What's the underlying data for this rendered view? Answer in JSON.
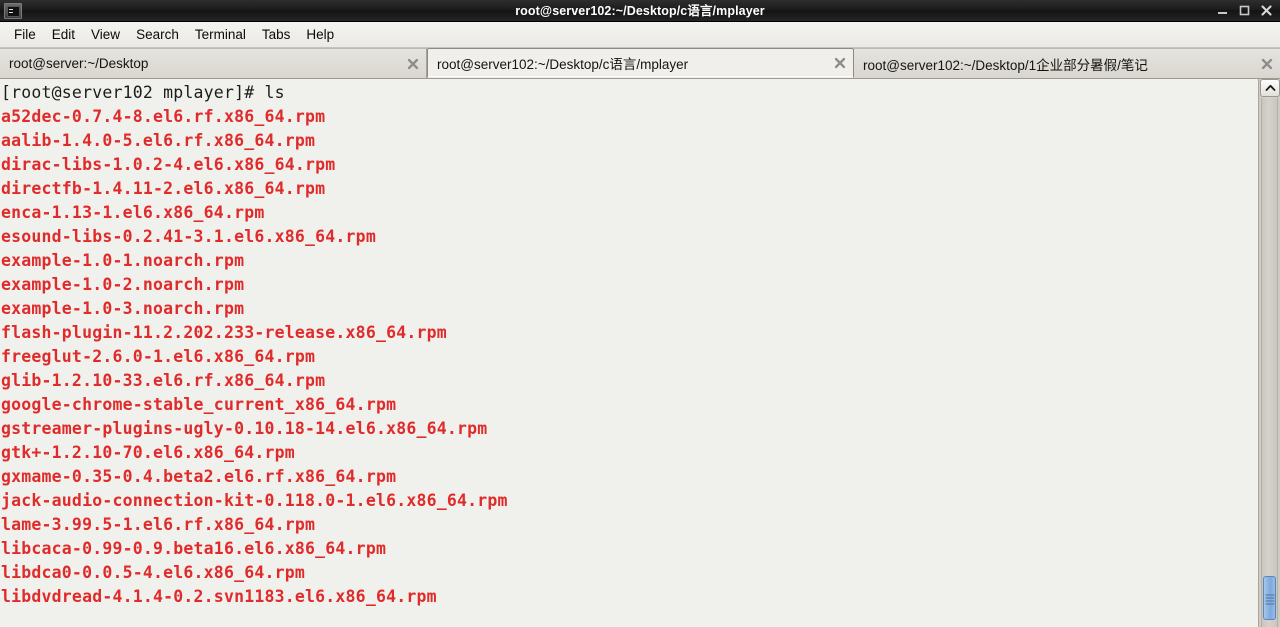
{
  "window": {
    "title": "root@server102:~/Desktop/c语言/mplayer",
    "icon": "terminal-icon",
    "minimize_label": "_",
    "maximize_label": "□",
    "close_label": "✕"
  },
  "menubar": {
    "items": [
      {
        "label": "File"
      },
      {
        "label": "Edit"
      },
      {
        "label": "View"
      },
      {
        "label": "Search"
      },
      {
        "label": "Terminal"
      },
      {
        "label": "Tabs"
      },
      {
        "label": "Help"
      }
    ]
  },
  "tabs": [
    {
      "label": "root@server:~/Desktop",
      "active": false,
      "close_icon": "close-icon"
    },
    {
      "label": "root@server102:~/Desktop/c语言/mplayer",
      "active": true,
      "close_icon": "close-icon"
    },
    {
      "label": "root@server102:~/Desktop/1企业部分暑假/笔记",
      "active": false,
      "close_icon": "close-icon"
    }
  ],
  "terminal": {
    "prompt_line": "[root@server102 mplayer]# ls",
    "prompt_color": "#1c1c1c",
    "file_color": "#e02b2b",
    "background_color": "#f0f0ec",
    "files": [
      "a52dec-0.7.4-8.el6.rf.x86_64.rpm",
      "aalib-1.4.0-5.el6.rf.x86_64.rpm",
      "dirac-libs-1.0.2-4.el6.x86_64.rpm",
      "directfb-1.4.11-2.el6.x86_64.rpm",
      "enca-1.13-1.el6.x86_64.rpm",
      "esound-libs-0.2.41-3.1.el6.x86_64.rpm",
      "example-1.0-1.noarch.rpm",
      "example-1.0-2.noarch.rpm",
      "example-1.0-3.noarch.rpm",
      "flash-plugin-11.2.202.233-release.x86_64.rpm",
      "freeglut-2.6.0-1.el6.x86_64.rpm",
      "glib-1.2.10-33.el6.rf.x86_64.rpm",
      "google-chrome-stable_current_x86_64.rpm",
      "gstreamer-plugins-ugly-0.10.18-14.el6.x86_64.rpm",
      "gtk+-1.2.10-70.el6.x86_64.rpm",
      "gxmame-0.35-0.4.beta2.el6.rf.x86_64.rpm",
      "jack-audio-connection-kit-0.118.0-1.el6.x86_64.rpm",
      "lame-3.99.5-1.el6.rf.x86_64.rpm",
      "libcaca-0.99-0.9.beta16.el6.x86_64.rpm",
      "libdca0-0.0.5-4.el6.x86_64.rpm",
      "libdvdread-4.1.4-0.2.svn1183.el6.x86_64.rpm"
    ]
  },
  "scrollbar": {
    "up_arrow_icon": "chevron-up-icon",
    "thumb_icon": "scroll-thumb-grip"
  }
}
